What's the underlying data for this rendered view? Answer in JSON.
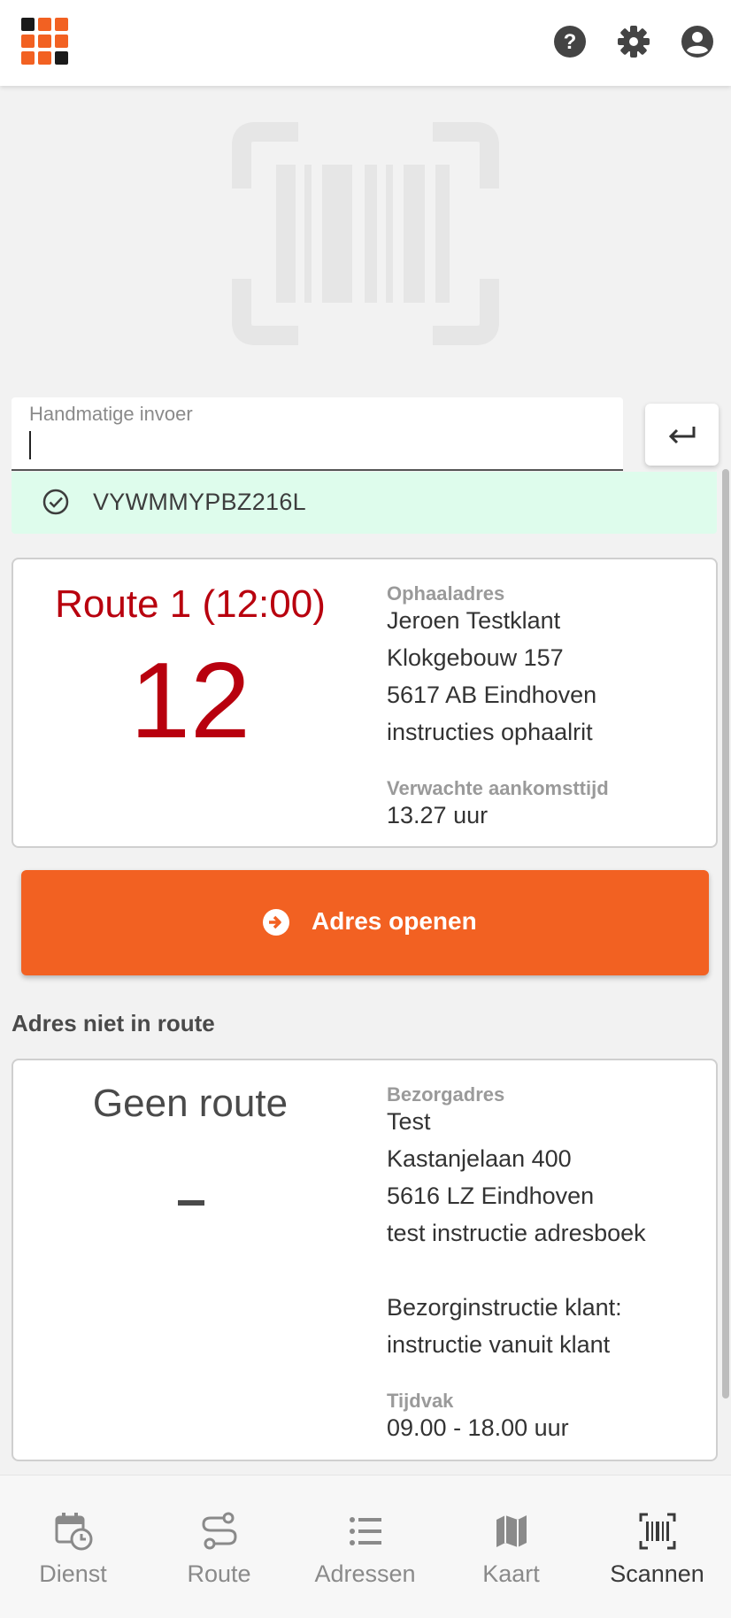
{
  "header": {
    "icons": [
      "help-icon",
      "settings-icon",
      "account-icon"
    ]
  },
  "scanner": {
    "input_label": "Handmatige invoer",
    "input_value": "",
    "enter_icon": "enter-arrow-icon",
    "success_code": "VYWMMYPBZ216L"
  },
  "route_card": {
    "route_title": "Route 1 (12:00)",
    "stop_number": "12",
    "address_label": "Ophaaladres",
    "address_lines": [
      "Jeroen Testklant",
      "Klokgebouw 157",
      "5617 AB Eindhoven",
      "instructies ophaalrit"
    ],
    "eta_label": "Verwachte aankomsttijd",
    "eta_value": "13.27 uur"
  },
  "open_button": {
    "label": "Adres openen",
    "icon": "arrow-circle-icon"
  },
  "not_in_route": {
    "heading": "Adres niet in route",
    "title": "Geen route",
    "address_label": "Bezorgadres",
    "address_lines": [
      "Test",
      "Kastanjelaan 400",
      "5616 LZ Eindhoven",
      "test instructie adresboek"
    ],
    "instruction_lines": [
      "Bezorginstructie klant:",
      "instructie vanuit klant"
    ],
    "timeslot_label": "Tijdvak",
    "timeslot_value": "09.00 - 18.00 uur"
  },
  "bottom_nav": [
    {
      "label": "Dienst",
      "icon": "calendar-clock-icon",
      "active": false
    },
    {
      "label": "Route",
      "icon": "route-icon",
      "active": false
    },
    {
      "label": "Adressen",
      "icon": "list-icon",
      "active": false
    },
    {
      "label": "Kaart",
      "icon": "map-icon",
      "active": false
    },
    {
      "label": "Scannen",
      "icon": "barcode-icon",
      "active": true
    }
  ],
  "colors": {
    "brand_orange": "#f26122",
    "route_red": "#b8000e",
    "success_bg": "#defcec",
    "logo_dark": "#1a1a1a"
  }
}
